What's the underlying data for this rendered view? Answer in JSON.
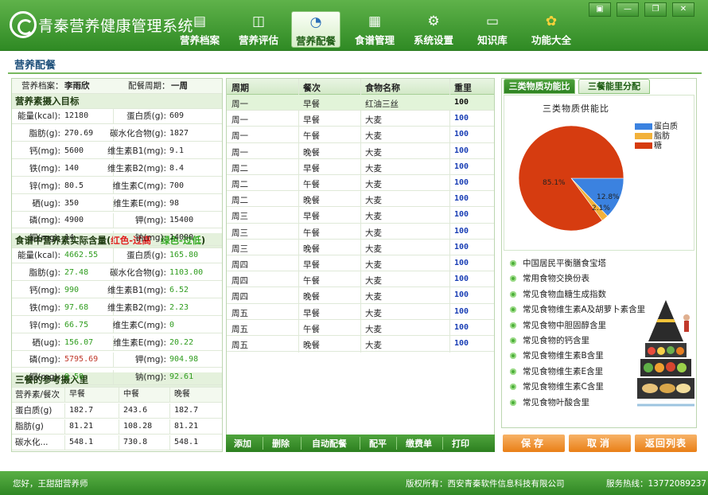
{
  "app": {
    "title": "青秦营养健康管理系统"
  },
  "nav": [
    {
      "label": "营养档案",
      "icon": "clipboard-icon"
    },
    {
      "label": "营养评估",
      "icon": "chart-icon"
    },
    {
      "label": "营养配餐",
      "icon": "pie-icon",
      "active": true
    },
    {
      "label": "食谱管理",
      "icon": "document-icon"
    },
    {
      "label": "系统设置",
      "icon": "gear-icon"
    },
    {
      "label": "知识库",
      "icon": "monitor-icon"
    },
    {
      "label": "功能大全",
      "icon": "flower-icon"
    }
  ],
  "page": {
    "title": "营养配餐"
  },
  "profile": {
    "label": "营养档案：",
    "name": "李雨欣",
    "period_label": "配餐周期：",
    "period": "一周"
  },
  "targets": {
    "title": "营养素摄入目标",
    "rows": [
      [
        {
          "label": "能量(kcal):",
          "value": "12180"
        },
        {
          "label": "蛋白质(g):",
          "value": "609"
        }
      ],
      [
        {
          "label": "脂肪(g):",
          "value": "270.69"
        },
        {
          "label": "碳水化合物(g):",
          "value": "1827"
        }
      ],
      [
        {
          "label": "钙(mg):",
          "value": "5600"
        },
        {
          "label": "维生素B1(mg):",
          "value": "9.1"
        }
      ],
      [
        {
          "label": "铁(mg):",
          "value": "140"
        },
        {
          "label": "维生素B2(mg):",
          "value": "8.4"
        }
      ],
      [
        {
          "label": "锌(mg):",
          "value": "80.5"
        },
        {
          "label": "维生素C(mg):",
          "value": "700"
        }
      ],
      [
        {
          "label": "硒(ug):",
          "value": "350"
        },
        {
          "label": "维生素E(mg):",
          "value": "98"
        }
      ],
      [
        {
          "label": "磷(mg):",
          "value": "4900"
        },
        {
          "label": "钾(mg):",
          "value": "15400"
        }
      ],
      [
        {
          "label": "铜(mg):",
          "value": "14"
        },
        {
          "label": "钠(mg):",
          "value": "14000"
        }
      ]
    ]
  },
  "actual": {
    "title": "食谱中营养素实际含量(",
    "red_note": "红色-过高",
    "green_note": "绿色-过低",
    "close": ")",
    "rows": [
      [
        {
          "label": "能量(kcal):",
          "value": "4662.55",
          "c": "green"
        },
        {
          "label": "蛋白质(g):",
          "value": "165.80",
          "c": "green"
        }
      ],
      [
        {
          "label": "脂肪(g):",
          "value": "27.48",
          "c": "green"
        },
        {
          "label": "碳水化合物(g):",
          "value": "1103.00",
          "c": "green"
        }
      ],
      [
        {
          "label": "钙(mg):",
          "value": "990",
          "c": "green"
        },
        {
          "label": "维生素B1(mg):",
          "value": "6.52",
          "c": "green"
        }
      ],
      [
        {
          "label": "铁(mg):",
          "value": "97.68",
          "c": "green"
        },
        {
          "label": "维生素B2(mg):",
          "value": "2.23",
          "c": "green"
        }
      ],
      [
        {
          "label": "锌(mg):",
          "value": "66.75",
          "c": "green"
        },
        {
          "label": "维生素C(mg):",
          "value": "0",
          "c": "green"
        }
      ],
      [
        {
          "label": "硒(ug):",
          "value": "156.07",
          "c": "green"
        },
        {
          "label": "维生素E(mg):",
          "value": "20.22",
          "c": "green"
        }
      ],
      [
        {
          "label": "磷(mg):",
          "value": "5795.69",
          "c": "red"
        },
        {
          "label": "钾(mg):",
          "value": "904.98",
          "c": "green"
        }
      ],
      [
        {
          "label": "铜(mg):",
          "value": "9.50",
          "c": "green"
        },
        {
          "label": "钠(mg):",
          "value": "92.61",
          "c": "green"
        }
      ]
    ]
  },
  "meals_ref": {
    "title": "三餐的参考摄入里",
    "headers": [
      "营养素/餐次",
      "早餐",
      "中餐",
      "晚餐"
    ],
    "rows": [
      [
        "蛋白质(g)",
        "182.7",
        "243.6",
        "182.7"
      ],
      [
        "脂肪(g)",
        "81.21",
        "108.28",
        "81.21"
      ],
      [
        "碳水化...",
        "548.1",
        "730.8",
        "548.1"
      ]
    ]
  },
  "grid": {
    "headers": [
      "周期",
      "餐次",
      "食物名称",
      "重里"
    ],
    "rows": [
      [
        "周一",
        "早餐",
        "红油三丝",
        "100"
      ],
      [
        "周一",
        "早餐",
        "大麦",
        "100"
      ],
      [
        "周一",
        "午餐",
        "大麦",
        "100"
      ],
      [
        "周一",
        "晚餐",
        "大麦",
        "100"
      ],
      [
        "周二",
        "早餐",
        "大麦",
        "100"
      ],
      [
        "周二",
        "午餐",
        "大麦",
        "100"
      ],
      [
        "周二",
        "晚餐",
        "大麦",
        "100"
      ],
      [
        "周三",
        "早餐",
        "大麦",
        "100"
      ],
      [
        "周三",
        "午餐",
        "大麦",
        "100"
      ],
      [
        "周三",
        "晚餐",
        "大麦",
        "100"
      ],
      [
        "周四",
        "早餐",
        "大麦",
        "100"
      ],
      [
        "周四",
        "午餐",
        "大麦",
        "100"
      ],
      [
        "周四",
        "晚餐",
        "大麦",
        "100"
      ],
      [
        "周五",
        "早餐",
        "大麦",
        "100"
      ],
      [
        "周五",
        "午餐",
        "大麦",
        "100"
      ],
      [
        "周五",
        "晚餐",
        "大麦",
        "100"
      ]
    ]
  },
  "toolbar": [
    "添加",
    "删除",
    "自动配餐",
    "配平",
    "缴费单",
    "打印"
  ],
  "tabs": [
    "三类物质功能比",
    "三餐能里分配"
  ],
  "chart_data": {
    "type": "pie",
    "title": "三类物质供能比",
    "labels": [
      "蛋白质",
      "脂肪",
      "糖"
    ],
    "values": [
      12.8,
      2.1,
      85.1
    ],
    "colors": [
      "#3b82e0",
      "#f2b13a",
      "#d63c10"
    ],
    "data_labels": [
      "12.8%",
      "2.1%",
      "85.1%"
    ],
    "legend": "right"
  },
  "links": [
    "中国居民平衡膳食宝塔",
    "常用食物交换份表",
    "常见食物血糖生成指数",
    "常见食物维生素A及胡萝卜素含里",
    "常见食物中胆固醇含里",
    "常见食物的钙含里",
    "常见食物维生素B含里",
    "常见食物维生素E含里",
    "常见食物维生素C含里",
    "常见食物叶酸含里"
  ],
  "actions": [
    "保存",
    "取消",
    "返回列表"
  ],
  "status": {
    "greeting": "您好，王甜甜营养师",
    "copyright": "版权所有：西安青秦软件信息科技有限公司",
    "hotline": "服务热线：13772089237"
  }
}
